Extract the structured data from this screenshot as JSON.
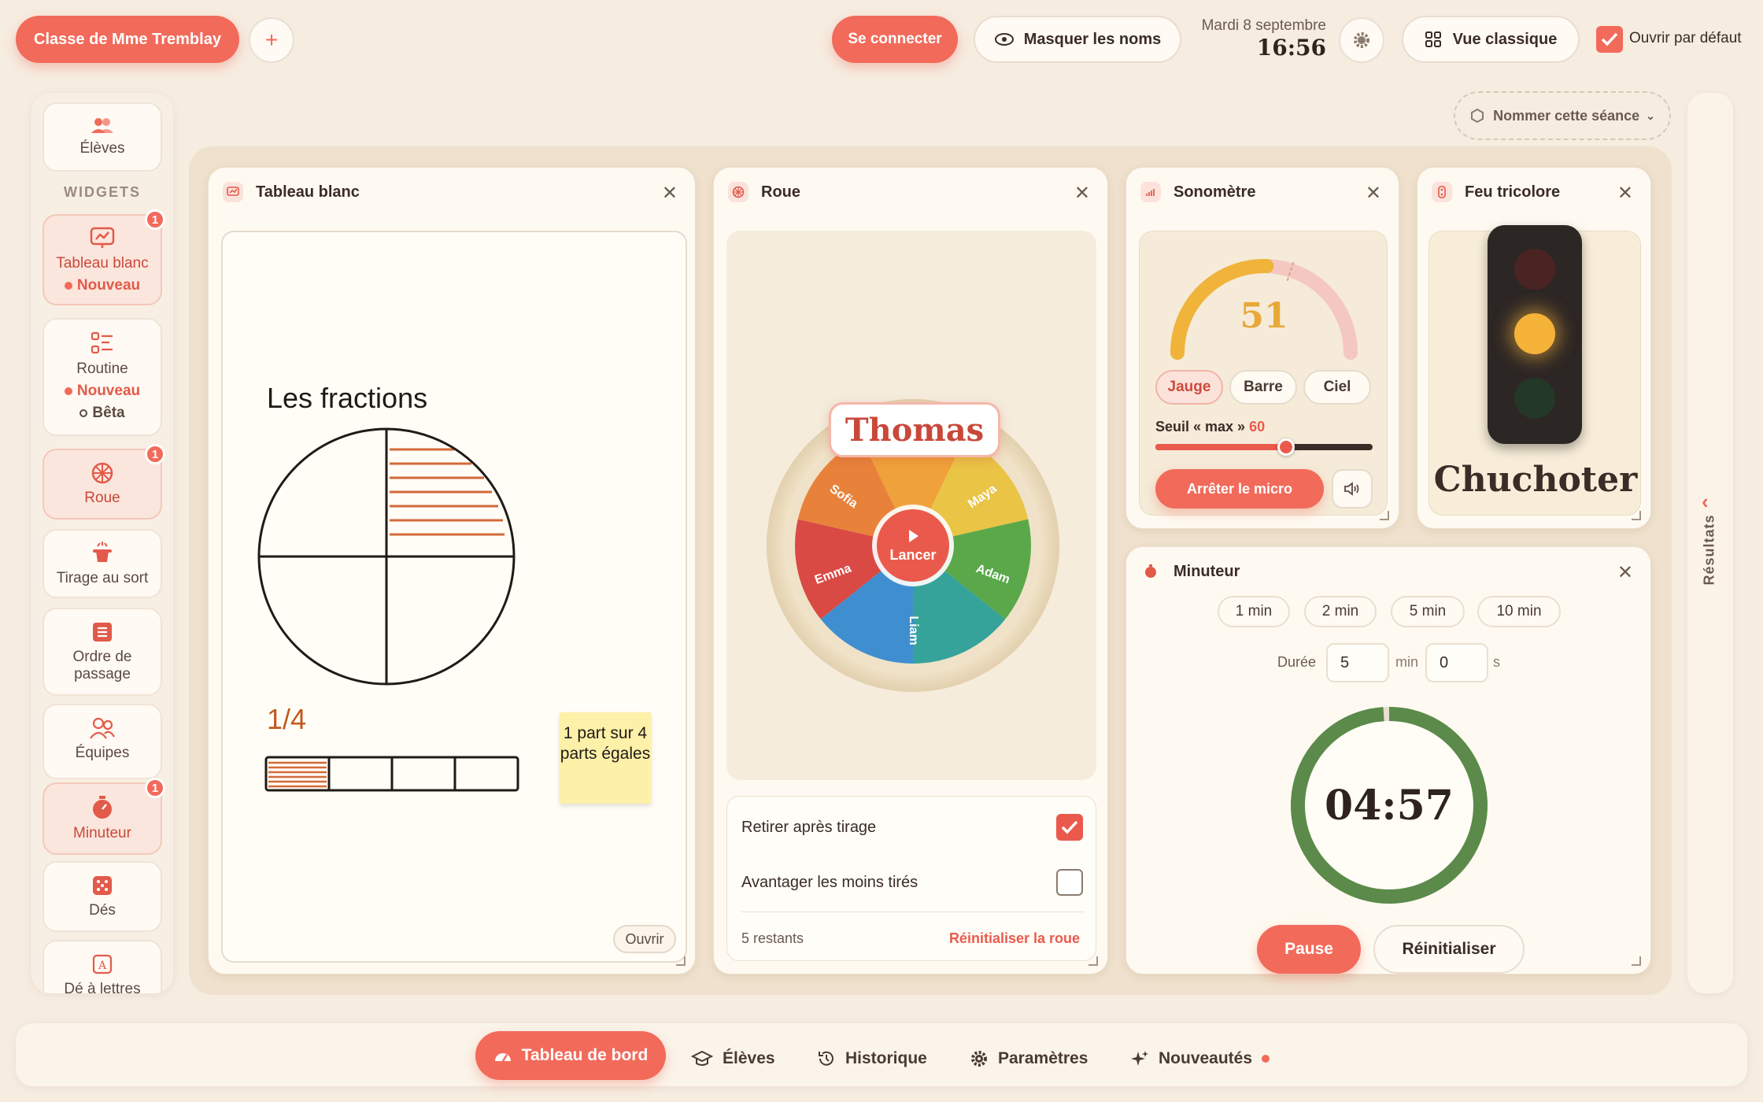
{
  "topbar": {
    "class_name": "Classe de Mme Tremblay",
    "add": "+",
    "connect": "Se connecter",
    "hide_names": "Masquer les noms",
    "date": "Mardi 8 septembre",
    "time": "16:56",
    "classic_view": "Vue classique",
    "open_default": "Ouvrir par défaut",
    "session_name": "Nommer cette séance"
  },
  "sidebar": {
    "students": "Élèves",
    "section": "WIDGETS",
    "items": [
      {
        "label": "Tableau blanc",
        "tag": "Nouveau",
        "badge": "1"
      },
      {
        "label": "Routine",
        "tag": "Nouveau",
        "tag2": "Bêta"
      },
      {
        "label": "Roue",
        "badge": "1"
      },
      {
        "label": "Tirage au sort"
      },
      {
        "label": "Ordre de passage"
      },
      {
        "label": "Équipes"
      },
      {
        "label": "Minuteur",
        "badge": "1"
      },
      {
        "label": "Dés"
      },
      {
        "label": "Dé à lettres"
      }
    ]
  },
  "whiteboard": {
    "title": "Tableau blanc",
    "heading": "Les fractions",
    "fraction": "1/4",
    "sticky": "1 part sur 4 parts égales",
    "open": "Ouvrir"
  },
  "wheel": {
    "title": "Roue",
    "winner": "Thomas",
    "spin": "Lancer",
    "names": [
      "Maya",
      "Adam",
      "Liam",
      "Emma",
      "Sofia"
    ],
    "opt1": "Retirer après tirage",
    "opt2": "Avantager les moins tirés",
    "remaining": "5 restants",
    "reset": "Réinitialiser la roue",
    "opt1_checked": true,
    "opt2_checked": false
  },
  "sound": {
    "title": "Sonomètre",
    "level": "51",
    "level_value": 51,
    "max_value": 60,
    "modes": [
      "Jauge",
      "Barre",
      "Ciel"
    ],
    "threshold_label": "Seuil « max »",
    "threshold": "60",
    "stop": "Arrêter le micro"
  },
  "traffic": {
    "title": "Feu tricolore",
    "state": "Chuchoter",
    "active_light": "yellow"
  },
  "timer": {
    "title": "Minuteur",
    "presets": [
      "1 min",
      "2 min",
      "5 min",
      "10 min"
    ],
    "duration_label": "Durée",
    "minutes": "5",
    "min_unit": "min",
    "seconds": "0",
    "sec_unit": "s",
    "display": "04:57",
    "remaining_fraction": 0.99,
    "pause": "Pause",
    "reset": "Réinitialiser"
  },
  "results_tab": "Résultats",
  "bottom_nav": {
    "items": [
      {
        "label": "Tableau de bord",
        "active": true
      },
      {
        "label": "Élèves"
      },
      {
        "label": "Historique"
      },
      {
        "label": "Paramètres"
      },
      {
        "label": "Nouveautés",
        "dot": true
      }
    ]
  },
  "colors": {
    "accent": "#f26a5a",
    "wheel": [
      "#f0a23a",
      "#e9c445",
      "#5aa84a",
      "#36a39a",
      "#3f8fd0",
      "#d94a45",
      "#e8823a"
    ],
    "timer_ring": "#5b8a4a",
    "gauge": "#f0b43a"
  }
}
